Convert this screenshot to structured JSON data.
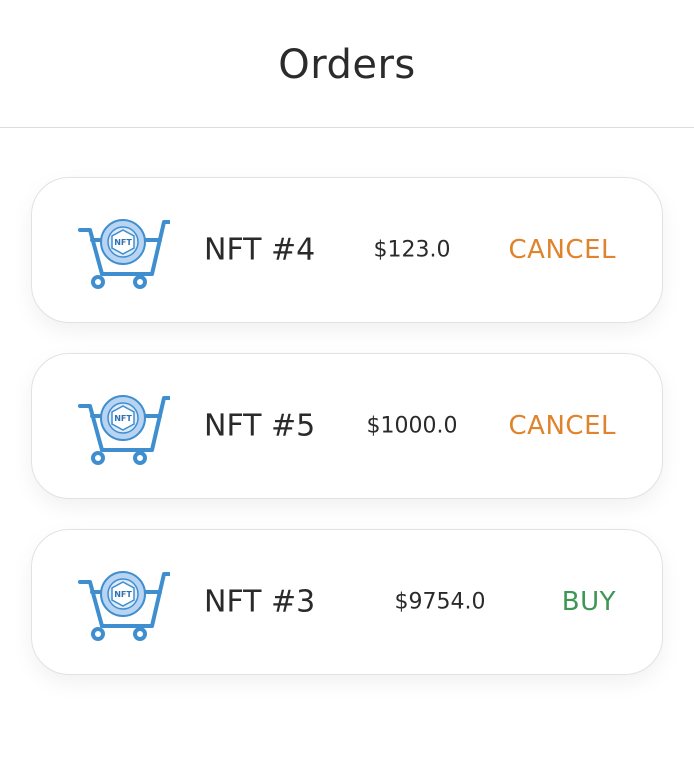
{
  "header": {
    "title": "Orders"
  },
  "colors": {
    "cancel": "#e0832d",
    "buy": "#3e9654",
    "icon_blue": "#3f8fd0",
    "icon_light": "#b9d3f2"
  },
  "orders": [
    {
      "icon": "nft-cart-icon",
      "icon_label": "NFT",
      "name": "NFT #4",
      "price": "$123.0",
      "action": "CANCEL",
      "action_type": "cancel"
    },
    {
      "icon": "nft-cart-icon",
      "icon_label": "NFT",
      "name": "NFT #5",
      "price": "$1000.0",
      "action": "CANCEL",
      "action_type": "cancel"
    },
    {
      "icon": "nft-cart-icon",
      "icon_label": "NFT",
      "name": "NFT #3",
      "price": "$9754.0",
      "action": "BUY",
      "action_type": "buy"
    }
  ]
}
